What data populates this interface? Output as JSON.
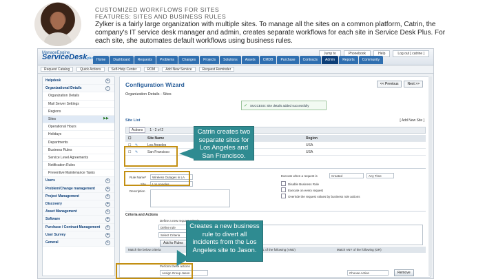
{
  "slide": {
    "heading_line1": "CUSTOMIZED WORKFLOWS FOR SITES",
    "heading_line2": "FEATURES: SITES AND BUSINESS RULES",
    "intro": "Zylker is a fairly large organization with multiple sites. To manage all the sites on a common platform, Catrin, the company's IT service desk manager and admin, creates separate workflows for each site in Service Desk Plus. For each site, she automates default workflows using business rules."
  },
  "app": {
    "logo_top": "ManageEngine",
    "logo_name": "ServiceDesk",
    "logo_suffix": "plus",
    "top_links": [
      "Jump to",
      "Phonebook",
      "Help",
      "Log out [ catrine ]"
    ],
    "tabs": [
      "Home",
      "Dashboard",
      "Requests",
      "Problems",
      "Changes",
      "Projects",
      "Solutions",
      "Assets",
      "CMDB",
      "Purchase",
      "Contracts",
      "Admin",
      "Reports",
      "Community"
    ],
    "active_tab": "Admin",
    "toolbar": [
      "Request Catalog",
      "Quick Actions",
      "Self-Help Center",
      "ROM",
      "Add New Service",
      "Request Reminder"
    ]
  },
  "sidebar": {
    "items": [
      {
        "label": "Helpdesk",
        "group": true,
        "toggle": "+"
      },
      {
        "label": "Organizational Details",
        "group": true,
        "toggle": "-"
      },
      {
        "label": "Organization Details",
        "group": false
      },
      {
        "label": "Mail Server Settings",
        "group": false
      },
      {
        "label": "Regions",
        "group": false
      },
      {
        "label": "Sites",
        "group": false,
        "selected": true,
        "toggle": "▶▶"
      },
      {
        "label": "Operational Hours",
        "group": false
      },
      {
        "label": "Holidays",
        "group": false
      },
      {
        "label": "Departments",
        "group": false
      },
      {
        "label": "Business Rules",
        "group": false
      },
      {
        "label": "Service Level Agreements",
        "group": false
      },
      {
        "label": "Notification Rules",
        "group": false
      },
      {
        "label": "Preventive Maintenance Tasks",
        "group": false
      },
      {
        "label": "Users",
        "group": true,
        "toggle": "+"
      },
      {
        "label": "Problem/Change management",
        "group": true,
        "toggle": "+"
      },
      {
        "label": "Project Management",
        "group": true,
        "toggle": "+"
      },
      {
        "label": "Discovery",
        "group": true,
        "toggle": "+"
      },
      {
        "label": "Asset Management",
        "group": true,
        "toggle": "+"
      },
      {
        "label": "Software",
        "group": true,
        "toggle": "+"
      },
      {
        "label": "Purchase / Contract Management",
        "group": true,
        "toggle": "+"
      },
      {
        "label": "User Survey",
        "group": true,
        "toggle": "+"
      },
      {
        "label": "General",
        "group": true,
        "toggle": "+"
      }
    ]
  },
  "main": {
    "title": "Configuration Wizard",
    "prev_label": "<< Previous",
    "next_label": "Next >>",
    "subtitle": "Organization Details - Sites",
    "success_text": "SUCCESS: Site details added successfully",
    "site_list_label": "Site List",
    "add_site_label": "[ Add New Site ]",
    "actions_label": "Actions",
    "pager": "1 - 2 of 2",
    "columns": [
      "",
      "",
      "Site Name",
      "Region"
    ],
    "rows": [
      {
        "name": "Los Angeles",
        "region": "USA"
      },
      {
        "name": "San Francisco",
        "region": "USA"
      }
    ],
    "rule_name_label": "Rule Name*",
    "rule_name_value": "Wireless Outages in LA",
    "rule_site_label": "Site",
    "rule_site_value": "Los Angeles",
    "description_label": "Description",
    "execute_label": "Execute when a request is",
    "execute_value": "Created",
    "execute_time": "Any Time",
    "options": [
      "Disable Business Rule",
      "Execute on every request",
      "Override the request values by business rule actions"
    ],
    "criteria_section": "Criteria and Actions",
    "set_rule_label": "Define a new request criteria",
    "define_label": "Define rule",
    "sel_value": "Select Criteria",
    "add_rules_button": "Add to Rules",
    "match_text": "Match the below criteria",
    "match_all": "Match ALL of the following (AND)",
    "match_any": "Match ANY of the following (OR)",
    "rule_col": "Rule",
    "actions_header": "Perform these actions",
    "action_row": "Assign Group Jason",
    "remove_label": "Remove",
    "choose_action": "Choose Action"
  },
  "callouts": [
    {
      "text": "Catrin creates two separate sites for Los Angeles and San Francisco."
    },
    {
      "text": "Creates a new business rule to divert all incidents from the Los Angeles site to Jason."
    }
  ],
  "colors": {
    "callout": "#2f8b91",
    "highlight": "#c38f12",
    "accent": "#2f6fb0"
  }
}
